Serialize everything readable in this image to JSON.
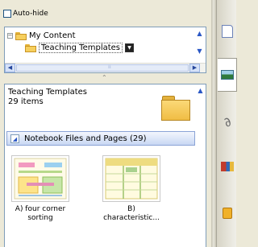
{
  "autohide": {
    "label": "Auto-hide",
    "checked": false
  },
  "tree": {
    "root_label": "My Content",
    "selected_label": "Teaching Templates"
  },
  "content": {
    "title": "Teaching Templates",
    "count": "29 items",
    "category": "Notebook Files and Pages (29)",
    "items": [
      {
        "caption_line1": "A)  four corner",
        "caption_line2": "sorting"
      },
      {
        "caption_line1": "B)",
        "caption_line2": "characteristic..."
      }
    ]
  },
  "sidebar": {
    "tabs": [
      {
        "icon": "page-sorter-icon"
      },
      {
        "icon": "gallery-icon"
      },
      {
        "icon": "attachments-icon"
      },
      {
        "icon": "properties-icon"
      },
      {
        "icon": "add-ons-icon"
      }
    ]
  },
  "colors": {
    "panel_bg": "#ece9d8",
    "category_bar": "#c8d7f3",
    "folder": "#f6cf5d",
    "border": "#7f9db9"
  }
}
